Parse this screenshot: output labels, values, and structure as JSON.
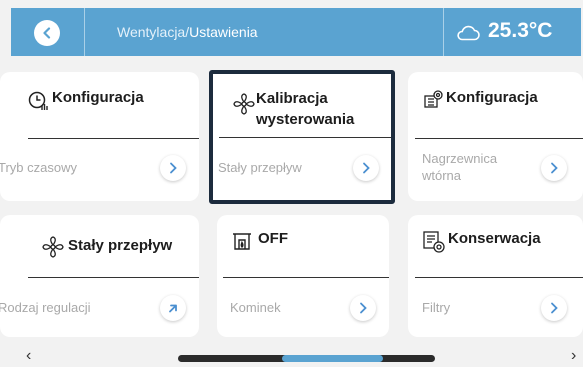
{
  "header": {
    "breadcrumb_parent": "Wentylacja/",
    "breadcrumb_current": "Ustawienia",
    "temperature": "25.3°C"
  },
  "cards": [
    {
      "title": "Konfiguracja",
      "subtitle": "Tryb czasowy",
      "icon": "clock-settings-icon",
      "arrow": "chevron-right-icon"
    },
    {
      "title_line1": "Kalibracja",
      "title_line2": "wysterowania",
      "subtitle": "Stały przepływ",
      "icon": "fan-icon",
      "arrow": "chevron-right-icon",
      "selected": true
    },
    {
      "title": "Konfiguracja",
      "subtitle_line1": "Nagrzewnica",
      "subtitle_line2": "wtórna",
      "icon": "heater-settings-icon",
      "arrow": "chevron-right-icon"
    },
    {
      "title": "Stały przepływ",
      "subtitle": "Rodzaj regulacji",
      "icon": "fan-icon",
      "arrow": "arrow-up-right-icon"
    },
    {
      "title": "OFF",
      "subtitle": "Kominek",
      "icon": "fireplace-icon",
      "arrow": "chevron-right-icon"
    },
    {
      "title": "Konserwacja",
      "subtitle": "Filtry",
      "icon": "maintenance-icon",
      "arrow": "chevron-right-icon"
    }
  ],
  "pager": {
    "prev": "‹",
    "next": "›",
    "scroll_position": 0.45
  },
  "colors": {
    "accent": "#5aa3d1",
    "selection": "#1c2b3d",
    "background": "#f2f2f2"
  }
}
